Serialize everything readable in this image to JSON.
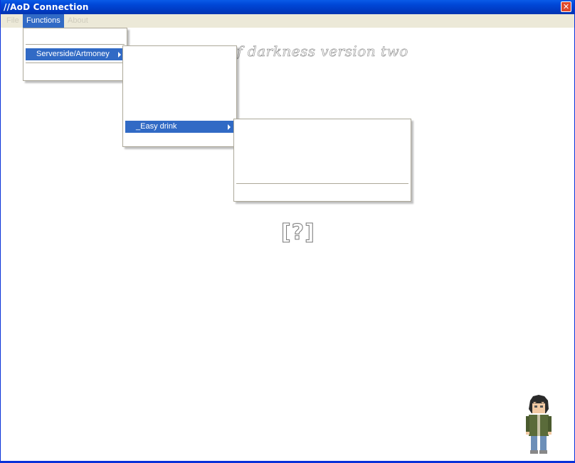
{
  "window": {
    "title": "//AoD Connection",
    "close_glyph": "✕"
  },
  "menubar": {
    "items": [
      {
        "label": "File",
        "active": false
      },
      {
        "label": "Functions",
        "active": true
      },
      {
        "label": "About",
        "active": false
      }
    ]
  },
  "heading": "//Army of darkness version two",
  "help_mark": "[?]",
  "menus": {
    "level1": {
      "highlighted_label": "Serverside/Artmoney"
    },
    "level2": {
      "highlighted_label": "_Easy drink"
    }
  },
  "colors": {
    "titlebar": "#0048d8",
    "highlight": "#316ac5",
    "menubar": "#ece9d8"
  }
}
